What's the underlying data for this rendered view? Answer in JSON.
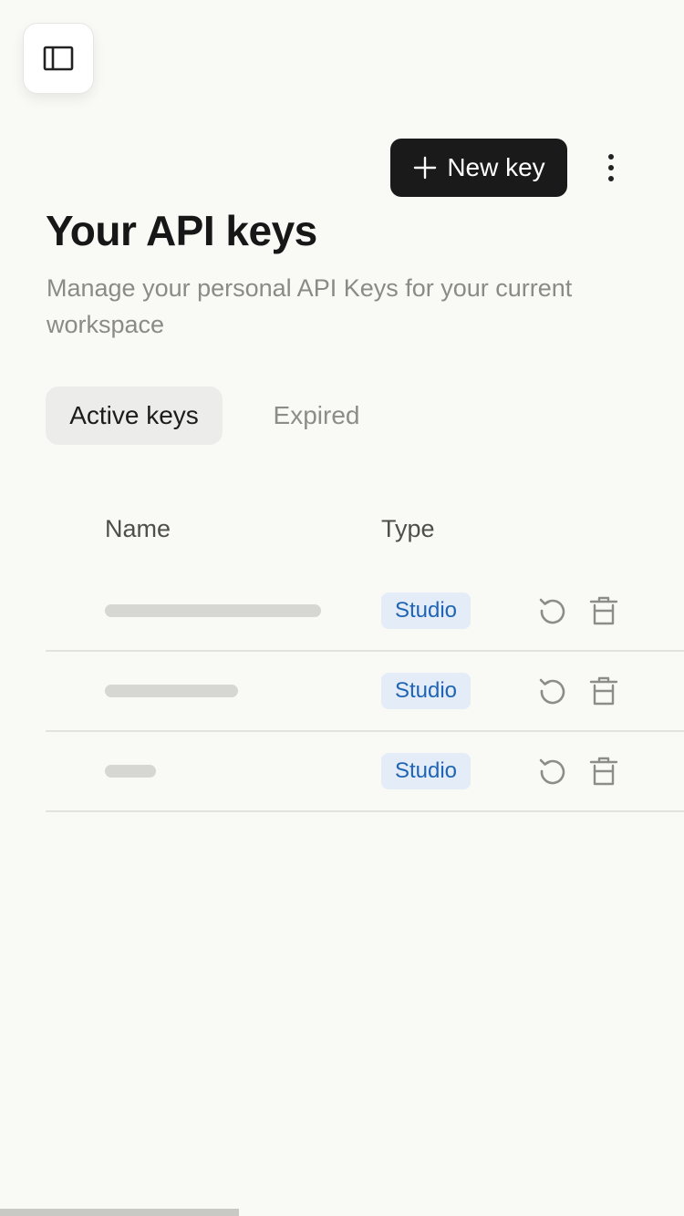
{
  "header": {
    "new_key_label": "New key"
  },
  "page": {
    "title": "Your API keys",
    "subtitle": "Manage your personal API Keys for your current workspace"
  },
  "tabs": [
    {
      "label": "Active keys",
      "active": true
    },
    {
      "label": "Expired",
      "active": false
    }
  ],
  "table": {
    "columns": [
      "Name",
      "Type"
    ],
    "rows": [
      {
        "type": "Studio"
      },
      {
        "type": "Studio"
      },
      {
        "type": "Studio"
      }
    ]
  },
  "icons": {
    "sidebar_toggle": "sidebar-panel-icon",
    "new_key": "plus-icon",
    "more": "vertical-ellipsis-icon",
    "rotate": "rotate-ccw-icon",
    "delete": "trash-icon"
  },
  "colors": {
    "background": "#f9f9f6",
    "primary_button": "#1a1a1a",
    "badge_bg": "#e4ecf7",
    "badge_text": "#1f64b5"
  }
}
